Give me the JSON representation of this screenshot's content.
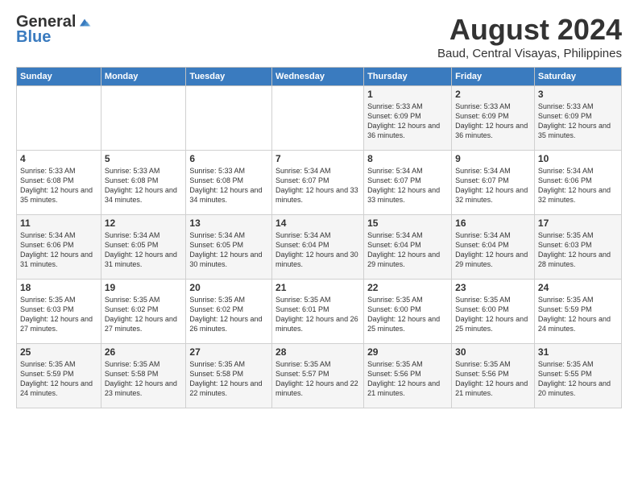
{
  "logo": {
    "general": "General",
    "blue": "Blue"
  },
  "header": {
    "month": "August 2024",
    "location": "Baud, Central Visayas, Philippines"
  },
  "weekdays": [
    "Sunday",
    "Monday",
    "Tuesday",
    "Wednesday",
    "Thursday",
    "Friday",
    "Saturday"
  ],
  "weeks": [
    [
      {
        "day": "",
        "sunrise": "",
        "sunset": "",
        "daylight": ""
      },
      {
        "day": "",
        "sunrise": "",
        "sunset": "",
        "daylight": ""
      },
      {
        "day": "",
        "sunrise": "",
        "sunset": "",
        "daylight": ""
      },
      {
        "day": "",
        "sunrise": "",
        "sunset": "",
        "daylight": ""
      },
      {
        "day": "1",
        "sunrise": "Sunrise: 5:33 AM",
        "sunset": "Sunset: 6:09 PM",
        "daylight": "Daylight: 12 hours and 36 minutes."
      },
      {
        "day": "2",
        "sunrise": "Sunrise: 5:33 AM",
        "sunset": "Sunset: 6:09 PM",
        "daylight": "Daylight: 12 hours and 36 minutes."
      },
      {
        "day": "3",
        "sunrise": "Sunrise: 5:33 AM",
        "sunset": "Sunset: 6:09 PM",
        "daylight": "Daylight: 12 hours and 35 minutes."
      }
    ],
    [
      {
        "day": "4",
        "sunrise": "Sunrise: 5:33 AM",
        "sunset": "Sunset: 6:08 PM",
        "daylight": "Daylight: 12 hours and 35 minutes."
      },
      {
        "day": "5",
        "sunrise": "Sunrise: 5:33 AM",
        "sunset": "Sunset: 6:08 PM",
        "daylight": "Daylight: 12 hours and 34 minutes."
      },
      {
        "day": "6",
        "sunrise": "Sunrise: 5:33 AM",
        "sunset": "Sunset: 6:08 PM",
        "daylight": "Daylight: 12 hours and 34 minutes."
      },
      {
        "day": "7",
        "sunrise": "Sunrise: 5:34 AM",
        "sunset": "Sunset: 6:07 PM",
        "daylight": "Daylight: 12 hours and 33 minutes."
      },
      {
        "day": "8",
        "sunrise": "Sunrise: 5:34 AM",
        "sunset": "Sunset: 6:07 PM",
        "daylight": "Daylight: 12 hours and 33 minutes."
      },
      {
        "day": "9",
        "sunrise": "Sunrise: 5:34 AM",
        "sunset": "Sunset: 6:07 PM",
        "daylight": "Daylight: 12 hours and 32 minutes."
      },
      {
        "day": "10",
        "sunrise": "Sunrise: 5:34 AM",
        "sunset": "Sunset: 6:06 PM",
        "daylight": "Daylight: 12 hours and 32 minutes."
      }
    ],
    [
      {
        "day": "11",
        "sunrise": "Sunrise: 5:34 AM",
        "sunset": "Sunset: 6:06 PM",
        "daylight": "Daylight: 12 hours and 31 minutes."
      },
      {
        "day": "12",
        "sunrise": "Sunrise: 5:34 AM",
        "sunset": "Sunset: 6:05 PM",
        "daylight": "Daylight: 12 hours and 31 minutes."
      },
      {
        "day": "13",
        "sunrise": "Sunrise: 5:34 AM",
        "sunset": "Sunset: 6:05 PM",
        "daylight": "Daylight: 12 hours and 30 minutes."
      },
      {
        "day": "14",
        "sunrise": "Sunrise: 5:34 AM",
        "sunset": "Sunset: 6:04 PM",
        "daylight": "Daylight: 12 hours and 30 minutes."
      },
      {
        "day": "15",
        "sunrise": "Sunrise: 5:34 AM",
        "sunset": "Sunset: 6:04 PM",
        "daylight": "Daylight: 12 hours and 29 minutes."
      },
      {
        "day": "16",
        "sunrise": "Sunrise: 5:34 AM",
        "sunset": "Sunset: 6:04 PM",
        "daylight": "Daylight: 12 hours and 29 minutes."
      },
      {
        "day": "17",
        "sunrise": "Sunrise: 5:35 AM",
        "sunset": "Sunset: 6:03 PM",
        "daylight": "Daylight: 12 hours and 28 minutes."
      }
    ],
    [
      {
        "day": "18",
        "sunrise": "Sunrise: 5:35 AM",
        "sunset": "Sunset: 6:03 PM",
        "daylight": "Daylight: 12 hours and 27 minutes."
      },
      {
        "day": "19",
        "sunrise": "Sunrise: 5:35 AM",
        "sunset": "Sunset: 6:02 PM",
        "daylight": "Daylight: 12 hours and 27 minutes."
      },
      {
        "day": "20",
        "sunrise": "Sunrise: 5:35 AM",
        "sunset": "Sunset: 6:02 PM",
        "daylight": "Daylight: 12 hours and 26 minutes."
      },
      {
        "day": "21",
        "sunrise": "Sunrise: 5:35 AM",
        "sunset": "Sunset: 6:01 PM",
        "daylight": "Daylight: 12 hours and 26 minutes."
      },
      {
        "day": "22",
        "sunrise": "Sunrise: 5:35 AM",
        "sunset": "Sunset: 6:00 PM",
        "daylight": "Daylight: 12 hours and 25 minutes."
      },
      {
        "day": "23",
        "sunrise": "Sunrise: 5:35 AM",
        "sunset": "Sunset: 6:00 PM",
        "daylight": "Daylight: 12 hours and 25 minutes."
      },
      {
        "day": "24",
        "sunrise": "Sunrise: 5:35 AM",
        "sunset": "Sunset: 5:59 PM",
        "daylight": "Daylight: 12 hours and 24 minutes."
      }
    ],
    [
      {
        "day": "25",
        "sunrise": "Sunrise: 5:35 AM",
        "sunset": "Sunset: 5:59 PM",
        "daylight": "Daylight: 12 hours and 24 minutes."
      },
      {
        "day": "26",
        "sunrise": "Sunrise: 5:35 AM",
        "sunset": "Sunset: 5:58 PM",
        "daylight": "Daylight: 12 hours and 23 minutes."
      },
      {
        "day": "27",
        "sunrise": "Sunrise: 5:35 AM",
        "sunset": "Sunset: 5:58 PM",
        "daylight": "Daylight: 12 hours and 22 minutes."
      },
      {
        "day": "28",
        "sunrise": "Sunrise: 5:35 AM",
        "sunset": "Sunset: 5:57 PM",
        "daylight": "Daylight: 12 hours and 22 minutes."
      },
      {
        "day": "29",
        "sunrise": "Sunrise: 5:35 AM",
        "sunset": "Sunset: 5:56 PM",
        "daylight": "Daylight: 12 hours and 21 minutes."
      },
      {
        "day": "30",
        "sunrise": "Sunrise: 5:35 AM",
        "sunset": "Sunset: 5:56 PM",
        "daylight": "Daylight: 12 hours and 21 minutes."
      },
      {
        "day": "31",
        "sunrise": "Sunrise: 5:35 AM",
        "sunset": "Sunset: 5:55 PM",
        "daylight": "Daylight: 12 hours and 20 minutes."
      }
    ]
  ]
}
